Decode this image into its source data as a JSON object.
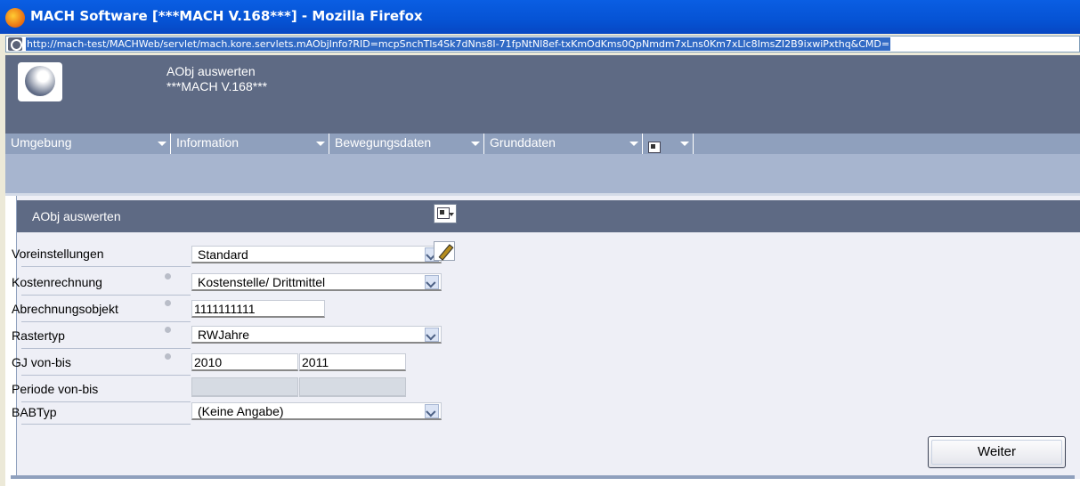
{
  "browser": {
    "title": "MACH Software [***MACH V.168***] - Mozilla Firefox",
    "url": "http://mach-test/MACHWeb/servlet/mach.kore.servlets.mAObjInfo?RID=mcpSnchTls4Sk7dNns8I-71fpNtNl8ef-txKmOdKms0QpNmdm7xLns0Km7xLlc8ImsZI2B9ixwiPxthq&CMD="
  },
  "header": {
    "title": "AObj auswerten",
    "subtitle": "***MACH V.168***"
  },
  "menu": {
    "items": [
      {
        "label": "Umgebung"
      },
      {
        "label": "Information"
      },
      {
        "label": "Bewegungsdaten"
      },
      {
        "label": "Grunddaten"
      }
    ]
  },
  "panel": {
    "title": "AObj auswerten"
  },
  "form": {
    "voreinstellungen": {
      "label": "Voreinstellungen",
      "value": "Standard"
    },
    "kostenrechnung": {
      "label": "Kostenrechnung",
      "value": "Kostenstelle/ Drittmittel"
    },
    "abrechnungsobjekt": {
      "label": "Abrechnungsobjekt",
      "value": "1111111111"
    },
    "rastertyp": {
      "label": "Rastertyp",
      "value": "RWJahre"
    },
    "gj": {
      "label": "GJ von-bis",
      "from": "2010",
      "to": "2011"
    },
    "periode": {
      "label": "Periode von-bis",
      "from": "",
      "to": ""
    },
    "babtyp": {
      "label": "BABTyp",
      "value": "(Keine Angabe)"
    }
  },
  "actions": {
    "next_label": "Weiter"
  },
  "colors": {
    "header_bg": "#5e6a84",
    "menu_bg": "#8fa0bd",
    "panel_bg": "#eeeff6",
    "titlebar": "#0653d4"
  },
  "icons": [
    "firefox-icon",
    "site-icon",
    "mach-logo",
    "tools-icon",
    "dropdown-arrow-icon",
    "pencil-icon"
  ]
}
